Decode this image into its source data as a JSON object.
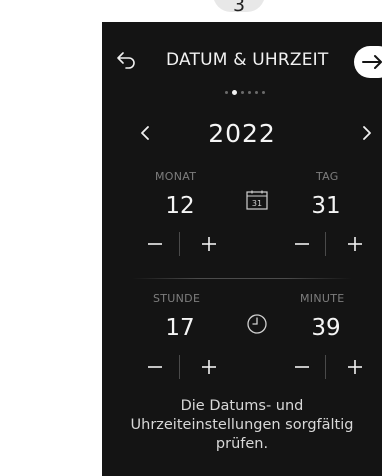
{
  "step": {
    "number": "3"
  },
  "header": {
    "title": "DATUM & UHRZEIT"
  },
  "pagination": {
    "total": 6,
    "active_index": 1
  },
  "year": {
    "value": "2022"
  },
  "date": {
    "month": {
      "label": "MONAT",
      "value": "12"
    },
    "day": {
      "label": "TAG",
      "value": "31"
    },
    "calendar_day": "31"
  },
  "time": {
    "hour": {
      "label": "STUNDE",
      "value": "17"
    },
    "minute": {
      "label": "MINUTE",
      "value": "39"
    }
  },
  "note": {
    "lines": [
      "Die Datums- und",
      "Uhrzeiteinstellungen sorgfältig",
      "prüfen."
    ]
  },
  "icons": {
    "back": "back-arrow-icon",
    "next": "forward-arrow-icon",
    "prev_year": "chevron-left-icon",
    "next_year": "chevron-right-icon",
    "calendar": "calendar-icon",
    "clock": "clock-icon"
  },
  "colors": {
    "screen_bg": "#141414",
    "text": "#f5f5f5",
    "muted": "#7d7d7d",
    "badge_bg": "#e8e8e8"
  }
}
